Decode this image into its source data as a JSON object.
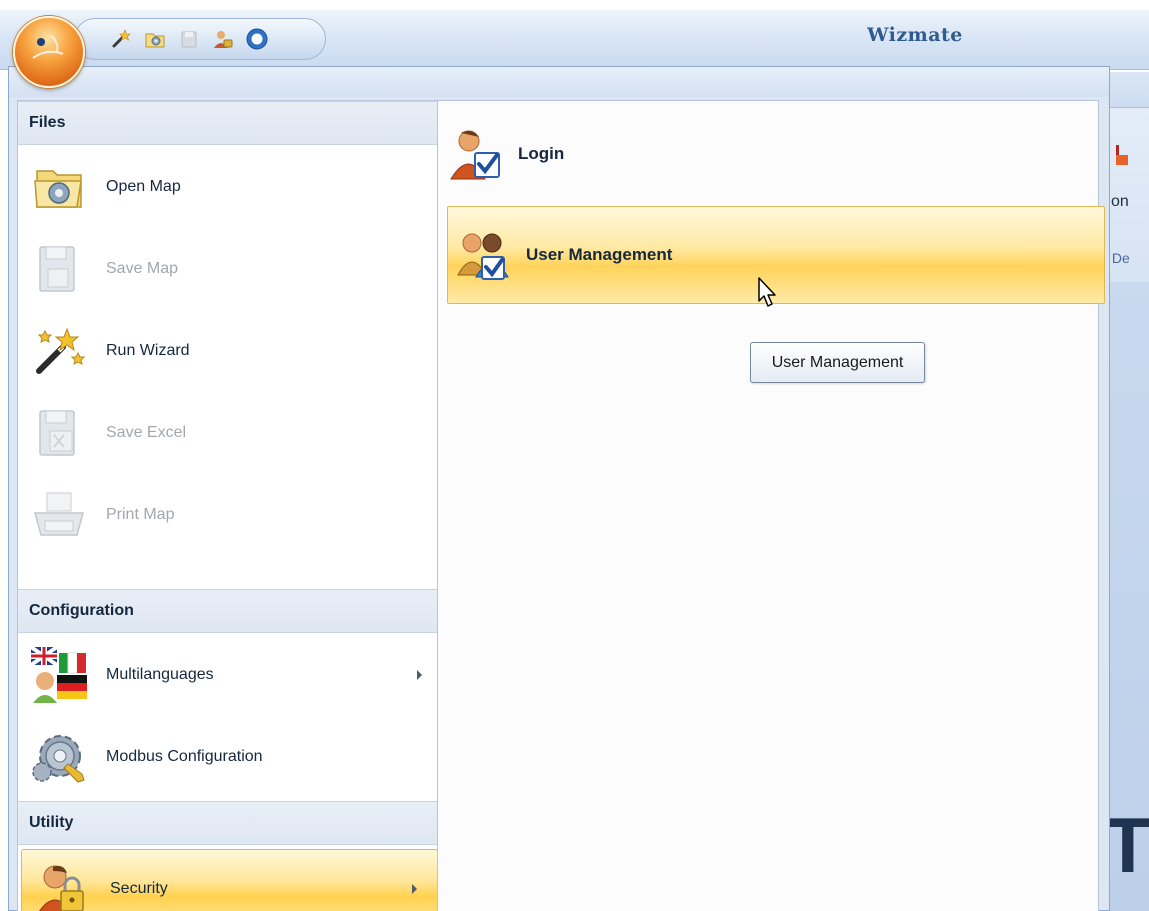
{
  "window": {
    "title": "Wizmate",
    "quick_access": [
      {
        "icon": "wand-icon",
        "enabled": true
      },
      {
        "icon": "open-folder-icon",
        "enabled": true
      },
      {
        "icon": "save-icon",
        "enabled": false
      },
      {
        "icon": "user-security-icon",
        "enabled": true
      },
      {
        "icon": "circle-icon",
        "enabled": true
      }
    ]
  },
  "background": {
    "ribbon_fragment_1": "tion",
    "ribbon_fragment_2": "s De",
    "workspace_glyph": "T"
  },
  "app_menu": {
    "sections": [
      {
        "title": "Files",
        "items": [
          {
            "label": "Open Map",
            "icon": "open-map-icon",
            "enabled": true
          },
          {
            "label": "Save Map",
            "icon": "save-map-icon",
            "enabled": false
          },
          {
            "label": "Run Wizard",
            "icon": "wizard-wand-icon",
            "enabled": true
          },
          {
            "label": "Save Excel",
            "icon": "save-excel-icon",
            "enabled": false
          },
          {
            "label": "Print Map",
            "icon": "printer-icon",
            "enabled": false
          }
        ]
      },
      {
        "title": "Configuration",
        "items": [
          {
            "label": "Multilanguages",
            "icon": "flags-icon",
            "enabled": true,
            "has_submenu": true
          },
          {
            "label": "Modbus Configuration",
            "icon": "gears-icon",
            "enabled": true
          }
        ]
      },
      {
        "title": "Utility",
        "items": [
          {
            "label": "Security",
            "icon": "user-lock-icon",
            "enabled": true,
            "has_submenu": true,
            "highlighted": true
          }
        ]
      }
    ],
    "submenu": {
      "items": [
        {
          "label": "Login",
          "icon": "user-check-icon"
        },
        {
          "label": "User Management",
          "icon": "users-check-icon",
          "highlighted": true
        }
      ]
    },
    "tooltip": "User Management"
  },
  "colors": {
    "highlight": "#ffd14e",
    "title_text": "#2f5c8e",
    "disabled_text": "#a3a7ad"
  }
}
